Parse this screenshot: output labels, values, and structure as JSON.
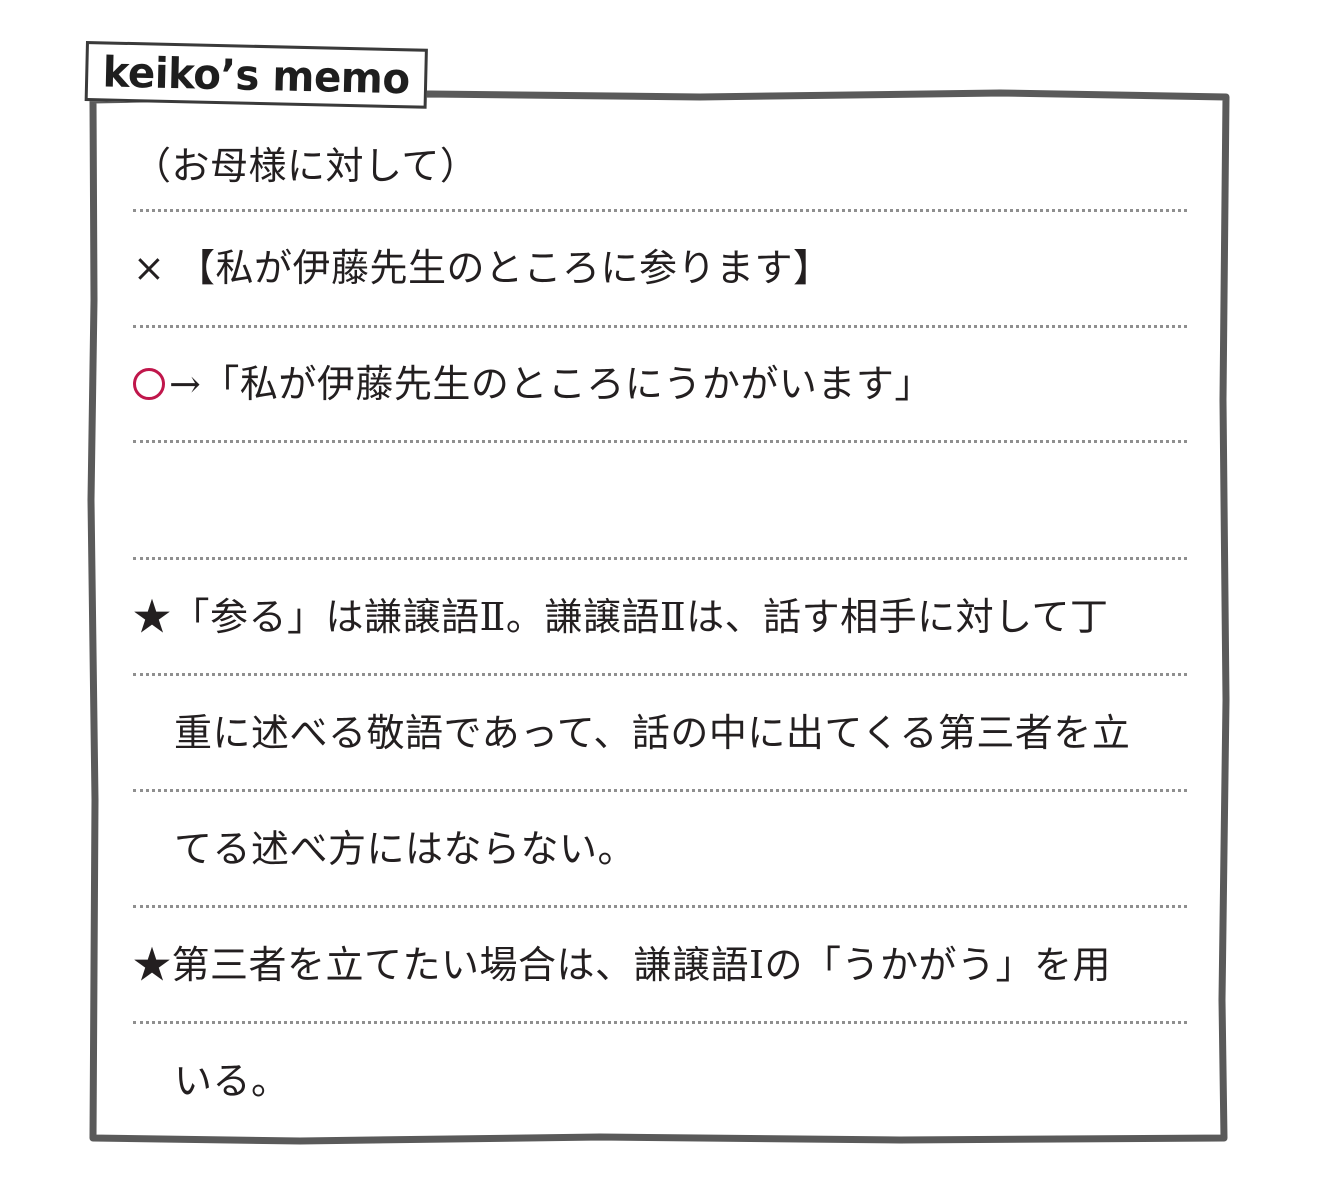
{
  "memo": {
    "tag_label": "keiko’s memo",
    "accent_color": "#c0164b",
    "frame_color": "#5a5a5a",
    "lines": {
      "context": "（お母様に対して）",
      "wrong_mark": "×",
      "wrong_text": "【私が伊藤先生のところに参ります】",
      "right_arrow": "→",
      "right_text": "「私が伊藤先生のところにうかがいます」",
      "note1_star": "★",
      "note1_line1": "「参る」は謙譲語Ⅱ。謙譲語Ⅱは、話す相手に対して丁",
      "note1_line2": "重に述べる敬語であって、話の中に出てくる第三者を立",
      "note1_line3": "てる述べ方にはならない。",
      "note2_star": "★",
      "note2_line1": "第三者を立てたい場合は、謙譲語Ⅰの「うかがう」を用",
      "note2_line2": "いる。"
    }
  }
}
